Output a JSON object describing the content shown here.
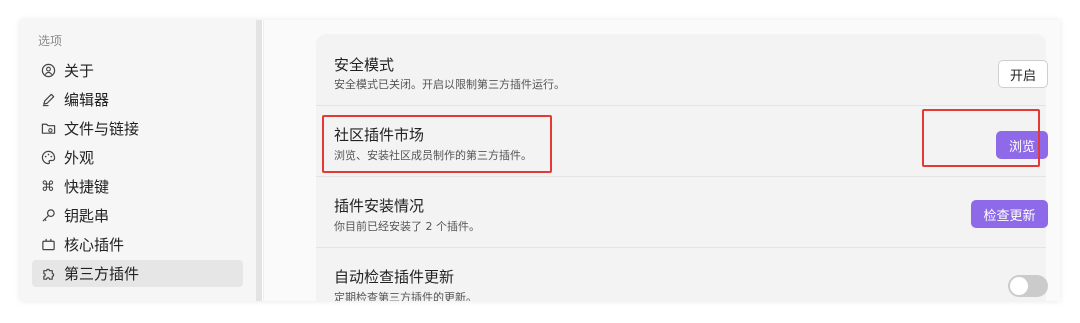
{
  "sidebar": {
    "section_label": "选项",
    "items": [
      {
        "label": "关于",
        "icon": "about-icon"
      },
      {
        "label": "编辑器",
        "icon": "pen-icon"
      },
      {
        "label": "文件与链接",
        "icon": "folder-link-icon"
      },
      {
        "label": "外观",
        "icon": "palette-icon"
      },
      {
        "label": "快捷键",
        "icon": "command-icon"
      },
      {
        "label": "钥匙串",
        "icon": "key-icon"
      },
      {
        "label": "核心插件",
        "icon": "plugin-icon"
      },
      {
        "label": "第三方插件",
        "icon": "puzzle-icon",
        "active": true
      }
    ]
  },
  "settings": [
    {
      "title": "安全模式",
      "desc": "安全模式已关闭。开启以限制第三方插件运行。",
      "button": "开启"
    },
    {
      "title": "社区插件市场",
      "desc": "浏览、安装社区成员制作的第三方插件。",
      "button": "浏览"
    },
    {
      "title": "插件安装情况",
      "desc": "你目前已经安装了 2 个插件。",
      "button": "检查更新"
    },
    {
      "title": "自动检查插件更新",
      "desc": "定期检查第三方插件的更新。",
      "toggle": false
    }
  ],
  "colors": {
    "accent": "#8f6ae8",
    "highlight": "#e53935"
  }
}
